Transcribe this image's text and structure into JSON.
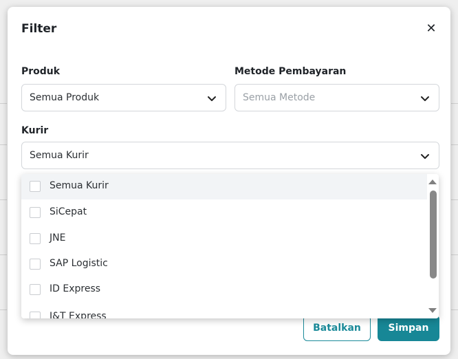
{
  "modal": {
    "title": "Filter",
    "close_symbol": "✕"
  },
  "fields": {
    "produk": {
      "label": "Produk",
      "value": "Semua Produk"
    },
    "metode": {
      "label": "Metode Pembayaran",
      "placeholder": "Semua Metode"
    },
    "kurir": {
      "label": "Kurir",
      "value": "Semua Kurir"
    }
  },
  "kurir_options": [
    {
      "label": "Semua Kurir",
      "checked": false
    },
    {
      "label": "SiCepat",
      "checked": false
    },
    {
      "label": "JNE",
      "checked": false
    },
    {
      "label": "SAP Logistic",
      "checked": false
    },
    {
      "label": "ID Express",
      "checked": false
    },
    {
      "label": "J&T Express",
      "checked": false
    }
  ],
  "buttons": {
    "cancel": "Batalkan",
    "save": "Simpan"
  },
  "colors": {
    "primary": "#178796"
  },
  "icons": {
    "close": "close-icon",
    "chevron": "chevron-down-icon"
  }
}
